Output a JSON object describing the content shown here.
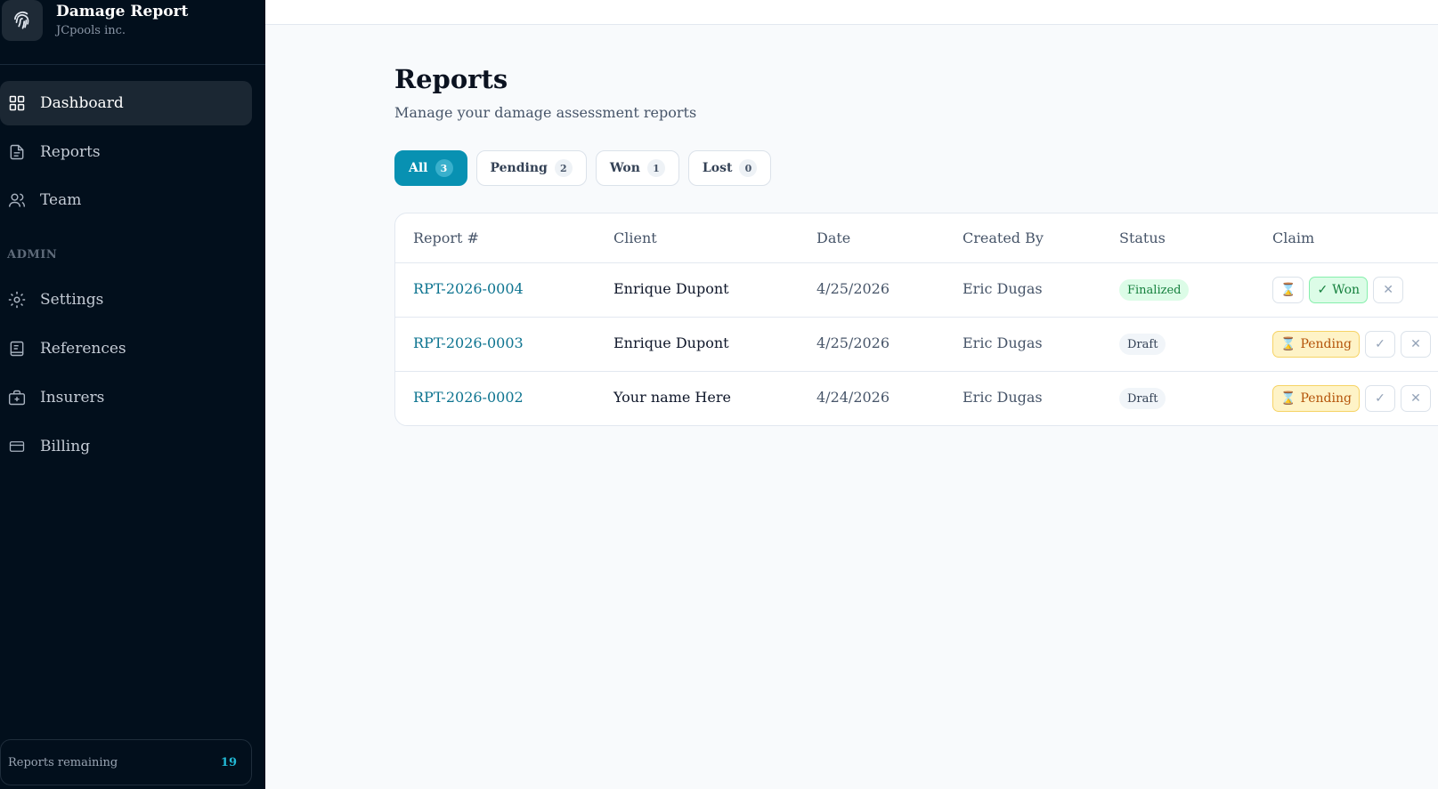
{
  "brand": {
    "title": "Damage Report",
    "subtitle": "JCpools inc.",
    "logo_icon": "fingerprint-icon"
  },
  "nav": {
    "items": [
      {
        "label": "Dashboard",
        "icon": "grid-icon",
        "active": true
      },
      {
        "label": "Reports",
        "icon": "document-icon"
      },
      {
        "label": "Team",
        "icon": "users-icon"
      }
    ],
    "admin_label": "ADMIN",
    "admin_items": [
      {
        "label": "Settings",
        "icon": "gear-icon"
      },
      {
        "label": "References",
        "icon": "book-icon"
      },
      {
        "label": "Insurers",
        "icon": "briefcase-medical-icon"
      },
      {
        "label": "Billing",
        "icon": "credit-card-icon"
      }
    ]
  },
  "usage": {
    "label": "Reports remaining",
    "count": "19"
  },
  "page": {
    "title": "Reports",
    "subtitle": "Manage your damage assessment reports"
  },
  "filters": [
    {
      "label": "All",
      "count": "3",
      "active": true
    },
    {
      "label": "Pending",
      "count": "2"
    },
    {
      "label": "Won",
      "count": "1"
    },
    {
      "label": "Lost",
      "count": "0"
    }
  ],
  "table": {
    "headers": [
      "Report #",
      "Client",
      "Date",
      "Created By",
      "Status",
      "Claim"
    ],
    "rows": [
      {
        "report": "RPT-2026-0004",
        "client": "Enrique Dupont",
        "date": "4/25/2026",
        "created_by": "Eric Dugas",
        "status": "Finalized",
        "claim": "won"
      },
      {
        "report": "RPT-2026-0003",
        "client": "Enrique Dupont",
        "date": "4/25/2026",
        "created_by": "Eric Dugas",
        "status": "Draft",
        "claim": "pending"
      },
      {
        "report": "RPT-2026-0002",
        "client": "Your name Here",
        "date": "4/24/2026",
        "created_by": "Eric Dugas",
        "status": "Draft",
        "claim": "pending"
      }
    ]
  },
  "claim_labels": {
    "pending": "Pending",
    "won": "Won"
  },
  "claim_glyphs": {
    "hourglass": "⌛",
    "check": "✓",
    "close": "✕"
  },
  "colors": {
    "sidebar_bg": "#020f1c",
    "accent": "#0891b2",
    "link": "#0e7490",
    "pending_bg": "#fef3c7",
    "won_bg": "#dcfce7"
  }
}
